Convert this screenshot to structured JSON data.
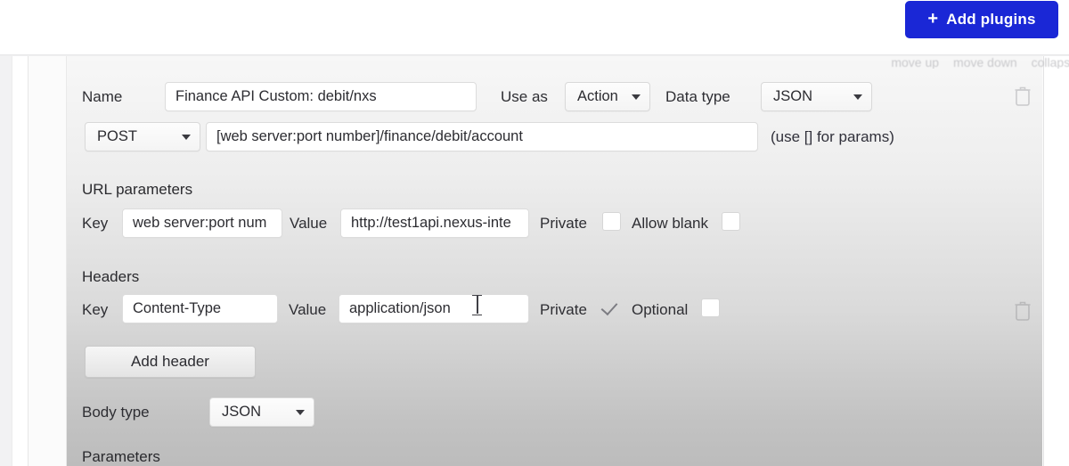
{
  "topbar": {
    "add_plugins_label": "Add plugins",
    "add_plugins_color": "#1a27d6",
    "plus_icon": "plus-icon"
  },
  "card_links": [
    {
      "label": "move up"
    },
    {
      "label": "move down"
    },
    {
      "label": "collapse"
    }
  ],
  "plugin": {
    "name_label": "Name",
    "name_value": "Finance API Custom: debit/nxs",
    "use_as_label": "Use as",
    "use_as_value": "Action",
    "data_type_label": "Data type",
    "data_type_value": "JSON",
    "delete_icon": "trash-icon",
    "method_value": "POST",
    "url_value": "[web server:port number]/finance/debit/account",
    "url_hint": "(use [] for params)"
  },
  "url_parameters": {
    "section_title": "URL parameters",
    "rows": [
      {
        "key_label": "Key",
        "key_value": "web server:port num",
        "value_label": "Value",
        "value_value": "http://test1api.nexus-inte",
        "private_label": "Private",
        "private_checked": false,
        "second_label": "Allow blank",
        "second_checked": false
      }
    ]
  },
  "headers": {
    "section_title": "Headers",
    "rows": [
      {
        "key_label": "Key",
        "key_value": "Content-Type",
        "value_label": "Value",
        "value_value": "application/json",
        "private_label": "Private",
        "private_checked": true,
        "second_label": "Optional",
        "second_checked": false,
        "delete_icon": "trash-icon"
      }
    ],
    "add_header_label": "Add header"
  },
  "body": {
    "body_type_label": "Body type",
    "body_type_value": "JSON",
    "parameters_title": "Parameters"
  }
}
